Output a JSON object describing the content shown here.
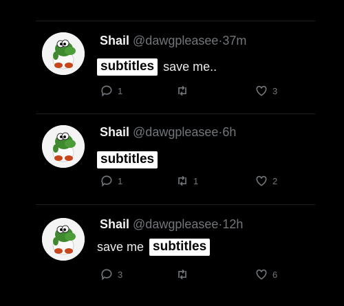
{
  "tweets": [
    {
      "name": "Shail",
      "handle": "@dawgpleasee",
      "dot": "·",
      "time": "37m",
      "caption": "subtitles",
      "text": "save me..",
      "replies": "1",
      "retweets": "",
      "likes": "3"
    },
    {
      "name": "Shail",
      "handle": "@dawgpleasee",
      "dot": "·",
      "time": "6h",
      "caption": "subtitles",
      "text": "",
      "replies": "1",
      "retweets": "1",
      "likes": "2"
    },
    {
      "name": "Shail",
      "handle": "@dawgpleasee",
      "dot": "·",
      "time": "12h",
      "caption": "subtitles",
      "text": "save me",
      "replies": "3",
      "retweets": "",
      "likes": "6"
    }
  ],
  "icons": {
    "avatar": "yoshi-avatar",
    "reply": "reply-icon",
    "retweet": "retweet-icon",
    "like": "heart-icon"
  },
  "colors": {
    "background": "#000000",
    "muted": "#71767b",
    "caption_bg": "#ffffff"
  }
}
